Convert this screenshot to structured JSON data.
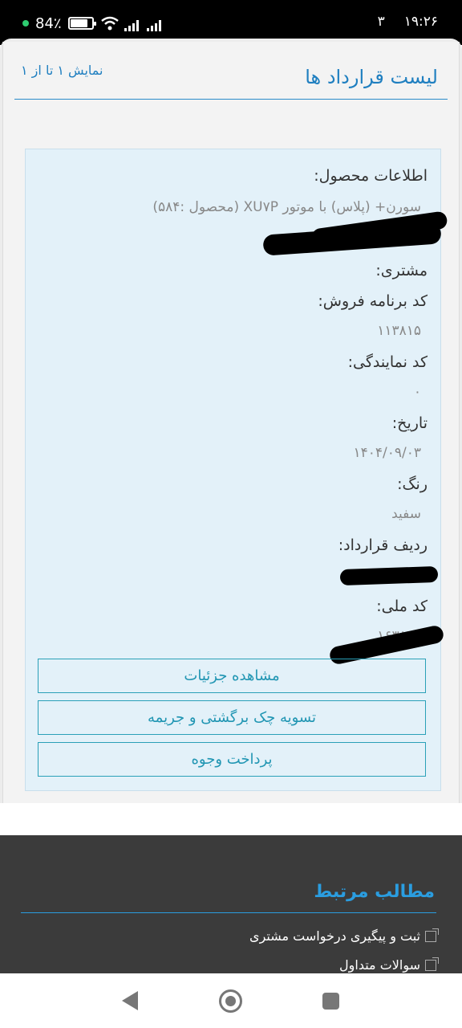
{
  "status_bar": {
    "battery_percent": "84٪",
    "battery_level": 0.84,
    "sim_indicator": "۳",
    "time": "۱۹:۲۶"
  },
  "header": {
    "title": "لیست قرارداد ها",
    "count_text": "نمایش ۱ تا از ۱"
  },
  "contract": {
    "product_info_label": "اطلاعات محصول:",
    "product_info_value": "سورن+ (پلاس) با موتور XU۷P (محصول :۵۸۴)",
    "customer_label": "مشتری:",
    "sales_code_label": "کد برنامه فروش:",
    "sales_code_value": "۱۱۳۸۱۵",
    "agency_code_label": "کد نمایندگی:",
    "agency_code_value": "۰",
    "date_label": "تاریخ:",
    "date_value": "۱۴۰۴/۰۹/۰۳",
    "color_label": "رنگ:",
    "color_value": "سفید",
    "contract_row_label": "ردیف قرارداد:",
    "national_code_label": "کد ملی:",
    "national_code_value": "۱۶۳۸۲۳"
  },
  "actions": {
    "details": "مشاهده جزئیات",
    "settle_check": "تسویه چک برگشتی و جریمه",
    "payment": "پرداخت وجوه"
  },
  "footer": {
    "title": "مطالب مرتبط",
    "links": [
      "ثبت و پیگیری درخواست مشتری",
      "سوالات متداول"
    ]
  },
  "colors": {
    "accent": "#1f7fc0",
    "card_bg": "#e3f1f9",
    "button_border": "#2aa0b8",
    "footer_bg": "#3b3b3b"
  }
}
